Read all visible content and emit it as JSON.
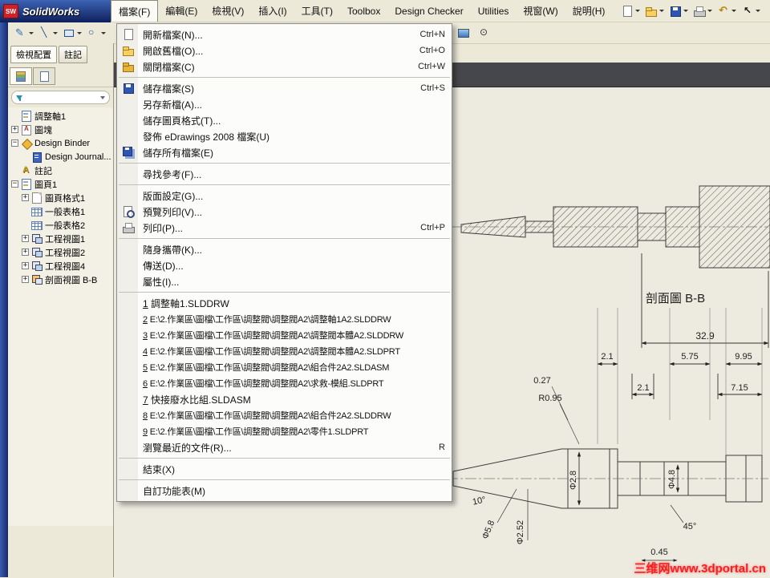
{
  "window": {
    "logo_abbr": "SW",
    "title": "SolidWorks"
  },
  "menubar": {
    "items": [
      {
        "label": "檔案(F)",
        "active": true
      },
      {
        "label": "編輯(E)",
        "active": false
      },
      {
        "label": "檢視(V)",
        "active": false
      },
      {
        "label": "插入(I)",
        "active": false
      },
      {
        "label": "工具(T)",
        "active": false
      },
      {
        "label": "Toolbox",
        "active": false
      },
      {
        "label": "Design Checker",
        "active": false
      },
      {
        "label": "Utilities",
        "active": false
      },
      {
        "label": "視窗(W)",
        "active": false
      },
      {
        "label": "說明(H)",
        "active": false
      }
    ]
  },
  "titlebar_tools": [
    {
      "name": "new-document-button",
      "icon": "new",
      "caret": true
    },
    {
      "name": "open-document-button",
      "icon": "open",
      "caret": true
    },
    {
      "name": "save-button",
      "icon": "save",
      "caret": true
    },
    {
      "name": "print-button",
      "icon": "print",
      "caret": true
    },
    {
      "name": "undo-button",
      "icon": "undo",
      "caret": true
    },
    {
      "name": "select-pointer-button",
      "icon": "pointer",
      "caret": true
    }
  ],
  "sketch_tools": [
    {
      "name": "sketch-button",
      "icon": "sketch",
      "caret": true
    },
    {
      "name": "line-tool-button",
      "icon": "line",
      "caret": true
    },
    {
      "name": "rectangle-tool-button",
      "icon": "rect",
      "caret": true
    },
    {
      "name": "circle-tool-button",
      "icon": "circle",
      "caret": true
    }
  ],
  "side_tools": [
    {
      "name": "image-tool-button",
      "icon": "image",
      "caret": false
    },
    {
      "name": "target-tool-button",
      "icon": "target",
      "caret": false
    }
  ],
  "file_menu": {
    "items": [
      {
        "label": "開新檔案(N)...",
        "shortcut": "Ctrl+N",
        "icon": "new"
      },
      {
        "label": "開啟舊檔(O)...",
        "shortcut": "Ctrl+O",
        "icon": "open"
      },
      {
        "label": "關閉檔案(C)",
        "shortcut": "Ctrl+W",
        "icon": "close"
      },
      {
        "type": "separator"
      },
      {
        "label": "儲存檔案(S)",
        "shortcut": "Ctrl+S",
        "icon": "save"
      },
      {
        "label": "另存新檔(A)..."
      },
      {
        "label": "儲存圖頁格式(T)..."
      },
      {
        "label": "發佈 eDrawings 2008 檔案(U)"
      },
      {
        "label": "儲存所有檔案(E)",
        "icon": "saveall"
      },
      {
        "type": "separator"
      },
      {
        "label": "尋找參考(F)..."
      },
      {
        "type": "separator"
      },
      {
        "label": "版面設定(G)..."
      },
      {
        "label": "預覽列印(V)...",
        "icon": "preview"
      },
      {
        "label": "列印(P)...",
        "shortcut": "Ctrl+P",
        "icon": "print"
      },
      {
        "type": "separator"
      },
      {
        "label": "隨身攜帶(K)..."
      },
      {
        "label": "傳送(D)..."
      },
      {
        "label": "屬性(I)..."
      },
      {
        "type": "separator"
      },
      {
        "num": "1",
        "label": "調整軸1.SLDDRW"
      },
      {
        "num": "2",
        "label": "E:\\2.作業區\\圖檔\\工作區\\調整閥\\調整閥A2\\調整軸1A2.SLDDRW"
      },
      {
        "num": "3",
        "label": "E:\\2.作業區\\圖檔\\工作區\\調整閥\\調整閥A2\\調整閥本體A2.SLDDRW"
      },
      {
        "num": "4",
        "label": "E:\\2.作業區\\圖檔\\工作區\\調整閥\\調整閥A2\\調整閥本體A2.SLDPRT"
      },
      {
        "num": "5",
        "label": "E:\\2.作業區\\圖檔\\工作區\\調整閥\\調整閥A2\\組合件2A2.SLDASM"
      },
      {
        "num": "6",
        "label": "E:\\2.作業區\\圖檔\\工作區\\調整閥\\調整閥A2\\求救-模組.SLDPRT"
      },
      {
        "num": "7",
        "label": "快接廢水比組.SLDASM"
      },
      {
        "num": "8",
        "label": "E:\\2.作業區\\圖檔\\工作區\\調整閥\\調整閥A2\\組合件2A2.SLDDRW"
      },
      {
        "num": "9",
        "label": "E:\\2.作業區\\圖檔\\工作區\\調整閥\\調整閥A2\\零件1.SLDPRT"
      },
      {
        "label": "瀏覽最近的文件(R)...",
        "shortcut": "R"
      },
      {
        "type": "separator"
      },
      {
        "label": "結束(X)"
      },
      {
        "type": "separator"
      },
      {
        "label": "自訂功能表(M)"
      }
    ]
  },
  "panel": {
    "tabs": [
      {
        "label": "檢視配置",
        "active": true
      },
      {
        "label": "註記",
        "active": false
      }
    ],
    "tree": [
      {
        "label": "調整軸1",
        "icon": "sheet",
        "level": 0,
        "expand": null
      },
      {
        "label": "圖塊",
        "icon": "block",
        "level": 0,
        "expand": "plus"
      },
      {
        "label": "Design Binder",
        "icon": "binder",
        "level": 0,
        "expand": "minus"
      },
      {
        "label": "Design Journal...",
        "icon": "journal",
        "level": 1,
        "expand": null
      },
      {
        "label": "註記",
        "icon": "ann",
        "level": 0,
        "expand": null
      },
      {
        "label": "圖頁1",
        "icon": "sheet2",
        "level": 0,
        "expand": "minus"
      },
      {
        "label": "圖頁格式1",
        "icon": "sheetfmt",
        "level": 1,
        "expand": "plus"
      },
      {
        "label": "一般表格1",
        "icon": "table",
        "level": 1,
        "expand": null
      },
      {
        "label": "一般表格2",
        "icon": "table",
        "level": 1,
        "expand": null
      },
      {
        "label": "工程視圖1",
        "icon": "view",
        "level": 1,
        "expand": "plus"
      },
      {
        "label": "工程視圖2",
        "icon": "view",
        "level": 1,
        "expand": "plus"
      },
      {
        "label": "工程視圖4",
        "icon": "view",
        "level": 1,
        "expand": "plus"
      },
      {
        "label": "剖面視圖 B-B",
        "icon": "section",
        "level": 1,
        "expand": "plus"
      }
    ]
  },
  "drawing": {
    "section_label": "剖面圖 B-B",
    "dims": {
      "overall": "32.9",
      "d21a": "2.1",
      "d575": "5.75",
      "d995": "9.95",
      "d027": "0.27",
      "r095": "R0.95",
      "d21b": "2.1",
      "d715": "7.15",
      "dia28": "Φ2.8",
      "dia58": "Φ5.8",
      "dia252": "Φ2.52",
      "dia48": "Φ4.8",
      "ang10": "10°",
      "ang45": "45°",
      "d045": "0.45"
    }
  },
  "watermark": {
    "text": "三维网www.3dportal.cn"
  }
}
